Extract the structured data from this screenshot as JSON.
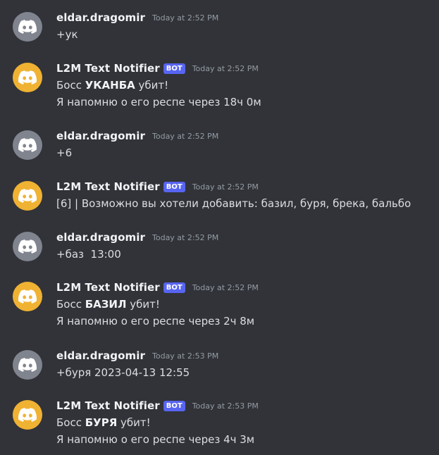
{
  "icon_names": {
    "avatar": "discord-logo-icon"
  },
  "colors": {
    "background": "#313338",
    "avatar_user": "#80848e",
    "avatar_bot": "#f0b232",
    "bot_tag": "#5865f2",
    "username": "#f2f3f5",
    "timestamp": "#949ba4",
    "text": "#dbdee1"
  },
  "messages": [
    {
      "author": "eldar.dragomir",
      "is_bot": false,
      "timestamp": "Today at 2:52 PM",
      "text": "+ук"
    },
    {
      "author": "L2M Text Notifier",
      "is_bot": true,
      "bot_tag": "BOT",
      "timestamp": "Today at 2:52 PM",
      "line1_prefix": "Босс ",
      "boss": "УКАНБА",
      "line1_suffix": " убит!",
      "line2": "Я напомню о его респе через 18ч 0м"
    },
    {
      "author": "eldar.dragomir",
      "is_bot": false,
      "timestamp": "Today at 2:52 PM",
      "text": "+6"
    },
    {
      "author": "L2M Text Notifier",
      "is_bot": true,
      "bot_tag": "BOT",
      "timestamp": "Today at 2:52 PM",
      "text": "[6] | Возможно вы хотели добавить: базил, буря, брека, бальбо"
    },
    {
      "author": "eldar.dragomir",
      "is_bot": false,
      "timestamp": "Today at 2:52 PM",
      "text": "+баз  13:00"
    },
    {
      "author": "L2M Text Notifier",
      "is_bot": true,
      "bot_tag": "BOT",
      "timestamp": "Today at 2:52 PM",
      "line1_prefix": "Босс ",
      "boss": "БАЗИЛ",
      "line1_suffix": " убит!",
      "line2": "Я напомню о его респе через 2ч 8м"
    },
    {
      "author": "eldar.dragomir",
      "is_bot": false,
      "timestamp": "Today at 2:53 PM",
      "text": "+буря 2023-04-13 12:55"
    },
    {
      "author": "L2M Text Notifier",
      "is_bot": true,
      "bot_tag": "BOT",
      "timestamp": "Today at 2:53 PM",
      "line1_prefix": "Босс ",
      "boss": "БУРЯ",
      "line1_suffix": " убит!",
      "line2": "Я напомню о его респе через 4ч 3м"
    }
  ]
}
